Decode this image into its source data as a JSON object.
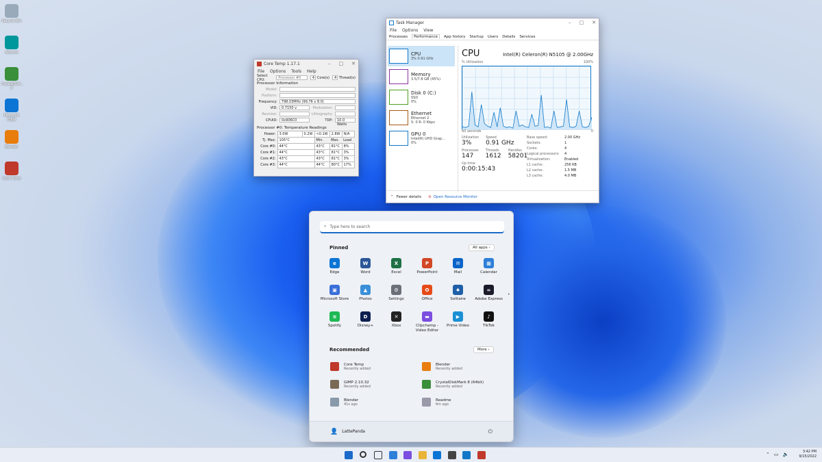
{
  "desktop": {
    "icons": [
      {
        "label": "Recycle Bin",
        "color": "#9ab"
      },
      {
        "label": "Arduino",
        "color": "#00979c"
      },
      {
        "label": "CrystalDisk... 8",
        "color": "#3a8f3a"
      },
      {
        "label": "Microsoft Edge",
        "color": "#0c74d4"
      },
      {
        "label": "Blender",
        "color": "#e87d0d"
      },
      {
        "label": "Core Temp",
        "color": "#c0392b"
      }
    ]
  },
  "coretemp": {
    "title": "Core Temp 1.17.1",
    "menu": [
      "File",
      "Options",
      "Tools",
      "Help"
    ],
    "select_cpu_label": "Select CPU:",
    "select_cpu_value": "Processor #0",
    "cores_value": "4",
    "cores_label": "Core(s)",
    "threads_value": "4",
    "threads_label": "Thread(s)",
    "proc_info_header": "Processor Information",
    "model_label": "Model:",
    "platform_label": "Platform:",
    "frequency_label": "Frequency:",
    "frequency_value": "798.03MHz (99.76 x 8.0)",
    "vid_label": "VID:",
    "vid_value": "0.7150 v",
    "modulation_label": "Modulation:",
    "revision_label": "Revision:",
    "lithography_label": "Lithography:",
    "cpuid_label": "CPUID:",
    "cpuid_value": "0x906C0",
    "tdp_label": "TDP:",
    "tdp_value": "10.0 Watts",
    "temp_header": "Processor #0: Temperature Readings",
    "power_label": "Power:",
    "power_values": [
      "3.0W",
      "0.2W",
      "<0.1W",
      "2.8W",
      "N/A"
    ],
    "tjmax_label": "Tj. Max:",
    "tjmax_value": "105°C",
    "col_min": "Min.",
    "col_max": "Max.",
    "col_load": "Load",
    "cores": [
      {
        "label": "Core #0:",
        "temp": "44°C",
        "min": "43°C",
        "max": "81°C",
        "load": "8%"
      },
      {
        "label": "Core #1:",
        "temp": "44°C",
        "min": "43°C",
        "max": "81°C",
        "load": "3%"
      },
      {
        "label": "Core #2:",
        "temp": "43°C",
        "min": "43°C",
        "max": "81°C",
        "load": "3%"
      },
      {
        "label": "Core #3:",
        "temp": "44°C",
        "min": "44°C",
        "max": "80°C",
        "load": "17%"
      }
    ]
  },
  "taskmgr": {
    "title": "Task Manager",
    "menu": [
      "File",
      "Options",
      "View"
    ],
    "tabs": [
      "Processes",
      "Performance",
      "App history",
      "Startup",
      "Users",
      "Details",
      "Services"
    ],
    "side": [
      {
        "name": "CPU",
        "sub1": "3% 0.91 GHz",
        "sub2": "",
        "color": "#1178c8"
      },
      {
        "name": "Memory",
        "sub1": "3.5/7.8 GB (45%)",
        "sub2": "",
        "color": "#8b2fa0"
      },
      {
        "name": "Disk 0 (C:)",
        "sub1": "SSD",
        "sub2": "0%",
        "color": "#4ca01e"
      },
      {
        "name": "Ethernet",
        "sub1": "Ethernet 2",
        "sub2": "S: 0 R: 0 Kbps",
        "color": "#a75a14"
      },
      {
        "name": "GPU 0",
        "sub1": "Intel(R) UHD Grap...",
        "sub2": "0%",
        "color": "#1178c8"
      }
    ],
    "heading": "CPU",
    "cpu_name": "Intel(R) Celeron(R) N5105 @ 2.00GHz",
    "util_label": "% Utilization",
    "util_max": "100%",
    "graph_left": "60 seconds",
    "graph_right": "0",
    "graph_values": [
      5,
      4,
      6,
      60,
      8,
      5,
      40,
      10,
      6,
      4,
      28,
      5,
      35,
      6,
      4,
      5,
      3,
      30,
      6,
      8,
      5,
      4,
      25,
      6,
      7,
      55,
      4,
      5,
      3,
      30,
      4,
      5,
      6,
      48,
      5,
      4,
      6,
      30,
      5,
      4,
      6,
      20
    ],
    "utilization_label": "Utilization",
    "utilization_value": "3%",
    "speed_label": "Speed",
    "speed_value": "0.91 GHz",
    "processes_label": "Processes",
    "processes_value": "147",
    "threads_label": "Threads",
    "threads_value": "1612",
    "handles_label": "Handles",
    "handles_value": "58201",
    "uptime_label": "Up time",
    "uptime_value": "0:00:15:43",
    "specs": [
      {
        "k": "Base speed:",
        "v": "2.00 GHz"
      },
      {
        "k": "Sockets:",
        "v": "1"
      },
      {
        "k": "Cores:",
        "v": "4"
      },
      {
        "k": "Logical processors:",
        "v": "4"
      },
      {
        "k": "Virtualization:",
        "v": "Enabled"
      },
      {
        "k": "L1 cache:",
        "v": "256 KB"
      },
      {
        "k": "L2 cache:",
        "v": "1.5 MB"
      },
      {
        "k": "L3 cache:",
        "v": "4.0 MB"
      }
    ],
    "fewer_details": "Fewer details",
    "open_resmon": "Open Resource Monitor"
  },
  "start": {
    "search_placeholder": "Type here to search",
    "pinned_label": "Pinned",
    "all_apps": "All apps  ›",
    "pinned": [
      {
        "name": "Edge",
        "color": "#0c74d4",
        "glyph": "e"
      },
      {
        "name": "Word",
        "color": "#2b5797",
        "glyph": "W"
      },
      {
        "name": "Excel",
        "color": "#1e7145",
        "glyph": "X"
      },
      {
        "name": "PowerPoint",
        "color": "#d24726",
        "glyph": "P"
      },
      {
        "name": "Mail",
        "color": "#0a64c8",
        "glyph": "✉"
      },
      {
        "name": "Calendar",
        "color": "#2d7fd8",
        "glyph": "▦"
      },
      {
        "name": "Microsoft Store",
        "color": "#3a6fd8",
        "glyph": "▣"
      },
      {
        "name": "Photos",
        "color": "#3b8fd8",
        "glyph": "▲"
      },
      {
        "name": "Settings",
        "color": "#6b6f78",
        "glyph": "⚙"
      },
      {
        "name": "Office",
        "color": "#e64a19",
        "glyph": "O"
      },
      {
        "name": "Solitaire",
        "color": "#1f5fa8",
        "glyph": "♠"
      },
      {
        "name": "Adobe Express",
        "color": "#1b1b2b",
        "glyph": "∞"
      },
      {
        "name": "Spotify",
        "color": "#1db954",
        "glyph": "≋"
      },
      {
        "name": "Disney+",
        "color": "#0b1e4f",
        "glyph": "D"
      },
      {
        "name": "Xbox",
        "color": "#222222",
        "glyph": "✕"
      },
      {
        "name": "Clipchamp - Video Editor",
        "color": "#7b4de0",
        "glyph": "▬"
      },
      {
        "name": "Prime Video",
        "color": "#1a8fd4",
        "glyph": "▶"
      },
      {
        "name": "TikTok",
        "color": "#111111",
        "glyph": "♪"
      }
    ],
    "recommended_label": "Recommended",
    "more": "More  ›",
    "recommended": [
      {
        "name": "Core Temp",
        "sub": "Recently added",
        "color": "#c0392b"
      },
      {
        "name": "Blender",
        "sub": "Recently added",
        "color": "#e87d0d"
      },
      {
        "name": "GIMP 2.10.32",
        "sub": "Recently added",
        "color": "#7a6a55"
      },
      {
        "name": "CrystalDiskMark 8 (64bit)",
        "sub": "Recently added",
        "color": "#3a8f3a"
      },
      {
        "name": "Blender",
        "sub": "41s ago",
        "color": "#8899aa"
      },
      {
        "name": "Readme",
        "sub": "6m ago",
        "color": "#99a"
      }
    ],
    "user": "LattePanda"
  },
  "taskbar": {
    "time": "3:42 PM",
    "date": "9/15/2022",
    "icons": [
      "windows-icon",
      "search-icon",
      "task-view-icon",
      "widgets-icon",
      "chat-icon",
      "file-explorer-icon",
      "edge-icon",
      "store-icon",
      "task-manager-icon",
      "core-temp-icon"
    ]
  }
}
